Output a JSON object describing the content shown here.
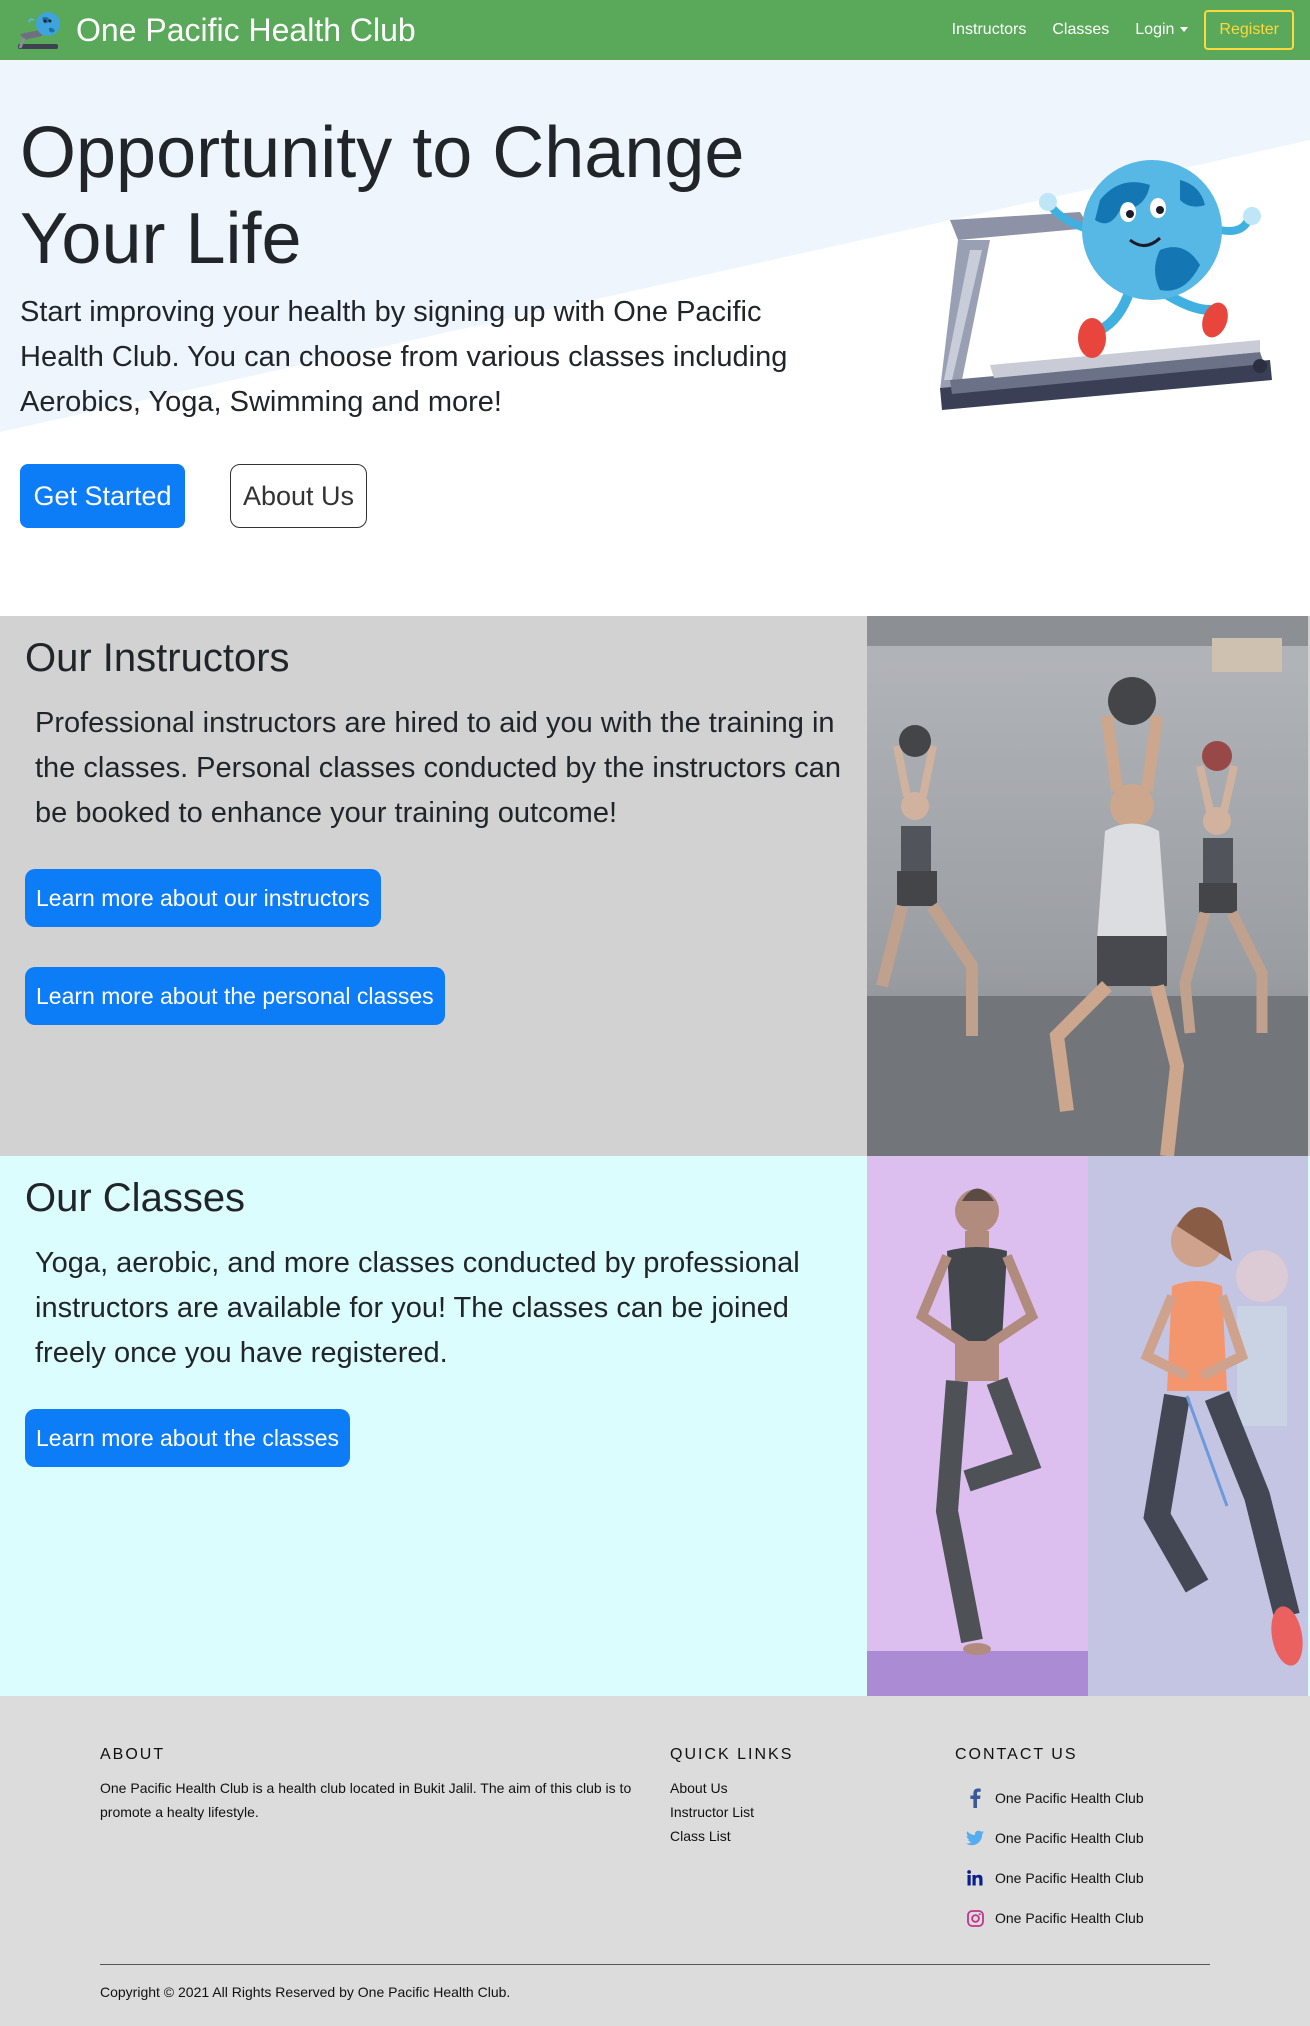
{
  "navbar": {
    "brand": "One Pacific Health Club",
    "links": {
      "instructors": "Instructors",
      "classes": "Classes",
      "login": "Login"
    },
    "register": "Register",
    "colors": {
      "bg": "#5aa95a",
      "register": "#ffd83b"
    }
  },
  "hero": {
    "title": "Opportunity to Change Your Life",
    "text": "Start improving your health by signing up with One Pacific Health Club. You can choose from various classes including Aerobics, Yoga, Swimming and more!",
    "get_started": "Get Started",
    "about_us": "About Us"
  },
  "instructors": {
    "title": "Our Instructors",
    "text": "Professional instructors are hired to aid you with the training in the classes. Personal classes conducted by the instructors can be booked to enhance your training outcome!",
    "btn_instructors": "Learn more about our instructors",
    "btn_personal": "Learn more about the personal classes",
    "bg": "#d2d2d2"
  },
  "classes": {
    "title": "Our Classes",
    "text": "Yoga, aerobic, and more classes conducted by professional instructors are available for you! The classes can be joined freely once you have registered.",
    "btn_classes": "Learn more about the classes",
    "bg": "#dcfdfd"
  },
  "footer": {
    "about_heading": "ABOUT",
    "about_text": "One Pacific Health Club is a health club located in Bukit Jalil. The aim of this club is to promote a healty lifestyle.",
    "quick_links_heading": "QUICK LINKS",
    "quick_links": [
      "About Us",
      "Instructor List",
      "Class List"
    ],
    "contact_heading": "CONTACT US",
    "contacts": [
      {
        "icon": "facebook-icon",
        "text": "One Pacific Health Club"
      },
      {
        "icon": "twitter-icon",
        "text": "One Pacific Health Club"
      },
      {
        "icon": "linkedin-icon",
        "text": "One Pacific Health Club"
      },
      {
        "icon": "instagram-icon",
        "text": "One Pacific Health Club"
      }
    ],
    "copyright": "Copyright © 2021 All Rights Reserved by One Pacific Health Club."
  },
  "accent": "#0d7cf7"
}
